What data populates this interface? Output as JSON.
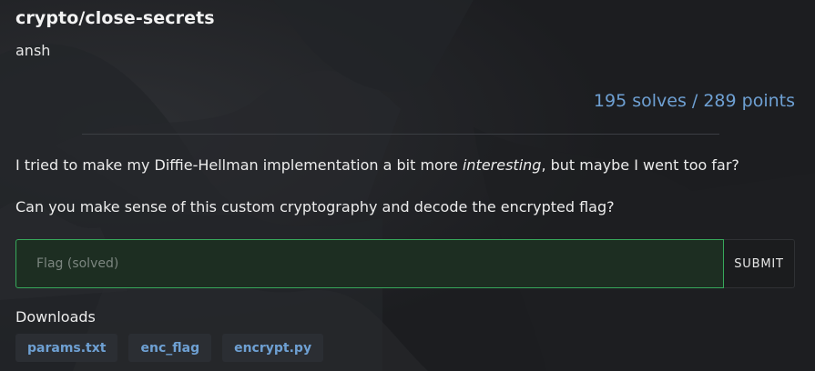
{
  "challenge": {
    "title": "crypto/close-secrets",
    "author": "ansh",
    "score": "195 solves / 289 points"
  },
  "description": {
    "line1_before": "I tried to make my Diffie-Hellman implementation a bit more ",
    "line1_emphasis": "interesting",
    "line1_after": ", but maybe I went too far?",
    "line2": "Can you make sense of this custom cryptography and decode the encrypted flag?"
  },
  "flag_form": {
    "placeholder": "Flag (solved)",
    "value": "",
    "submit_label": "SUBMIT"
  },
  "downloads": {
    "label": "Downloads",
    "files": [
      "params.txt",
      "enc_flag",
      "encrypt.py"
    ]
  },
  "colors": {
    "accent": "#6ea0d3",
    "input_border": "#37a85b",
    "background": "#1f2124"
  }
}
